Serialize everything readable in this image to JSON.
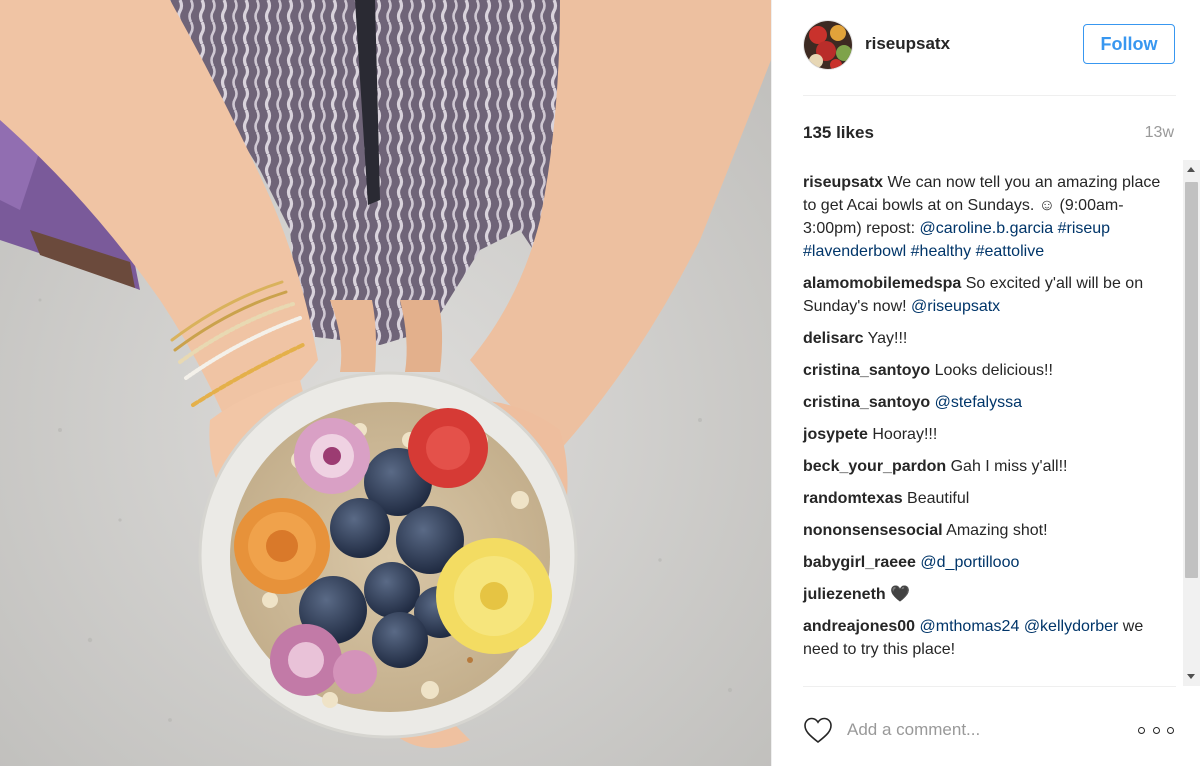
{
  "post": {
    "username": "riseupsatx",
    "follow_label": "Follow",
    "likes": "135 likes",
    "age": "13w",
    "comment_placeholder": "Add a comment..."
  },
  "comments": [
    {
      "user": "riseupsatx",
      "segments": [
        {
          "t": " We can now tell you an amazing place to get Acai bowls at on Sundays. ",
          "k": "text"
        },
        {
          "t": "☺",
          "k": "text"
        },
        {
          "t": " (9:00am-3:00pm) repost: ",
          "k": "text"
        },
        {
          "t": "@caroline.b.garcia",
          "k": "mention"
        },
        {
          "t": " ",
          "k": "text"
        },
        {
          "t": "#riseup",
          "k": "tag"
        },
        {
          "t": " ",
          "k": "text"
        },
        {
          "t": "#lavenderbowl",
          "k": "tag"
        },
        {
          "t": " ",
          "k": "text"
        },
        {
          "t": "#healthy",
          "k": "tag"
        },
        {
          "t": " ",
          "k": "text"
        },
        {
          "t": "#eattolive",
          "k": "tag"
        }
      ]
    },
    {
      "user": "alamomobilemedspa",
      "segments": [
        {
          "t": " So excited y'all will be on Sunday's now! ",
          "k": "text"
        },
        {
          "t": "@riseupsatx",
          "k": "mention"
        }
      ]
    },
    {
      "user": "delisarc",
      "segments": [
        {
          "t": " Yay!!!",
          "k": "text"
        }
      ]
    },
    {
      "user": "cristina_santoyo",
      "segments": [
        {
          "t": " Looks delicious!!",
          "k": "text"
        }
      ]
    },
    {
      "user": "cristina_santoyo",
      "segments": [
        {
          "t": " ",
          "k": "text"
        },
        {
          "t": "@stefalyssa",
          "k": "mention"
        }
      ]
    },
    {
      "user": "josypete",
      "segments": [
        {
          "t": " Hooray!!!",
          "k": "text"
        }
      ]
    },
    {
      "user": "beck_your_pardon",
      "segments": [
        {
          "t": " Gah I miss y'all!!",
          "k": "text"
        }
      ]
    },
    {
      "user": "randomtexas",
      "segments": [
        {
          "t": " Beautiful",
          "k": "text"
        }
      ]
    },
    {
      "user": "nononsensesocial",
      "segments": [
        {
          "t": " Amazing shot!",
          "k": "text"
        }
      ]
    },
    {
      "user": "babygirl_raeee",
      "segments": [
        {
          "t": " ",
          "k": "text"
        },
        {
          "t": "@d_portillooo",
          "k": "mention"
        }
      ]
    },
    {
      "user": "juliezeneth",
      "segments": [
        {
          "t": " 🖤",
          "k": "text"
        }
      ]
    },
    {
      "user": "andreajones00",
      "segments": [
        {
          "t": " ",
          "k": "text"
        },
        {
          "t": "@mthomas24",
          "k": "mention"
        },
        {
          "t": " ",
          "k": "text"
        },
        {
          "t": "@kellydorber",
          "k": "mention"
        },
        {
          "t": " we need to try this place!",
          "k": "text"
        }
      ]
    }
  ],
  "colors": {
    "accent": "#3897f0",
    "mention": "#003569",
    "muted": "#999999",
    "text": "#262626"
  },
  "icons": {
    "heart": "heart-outline-icon",
    "more": "more-options-icon"
  }
}
